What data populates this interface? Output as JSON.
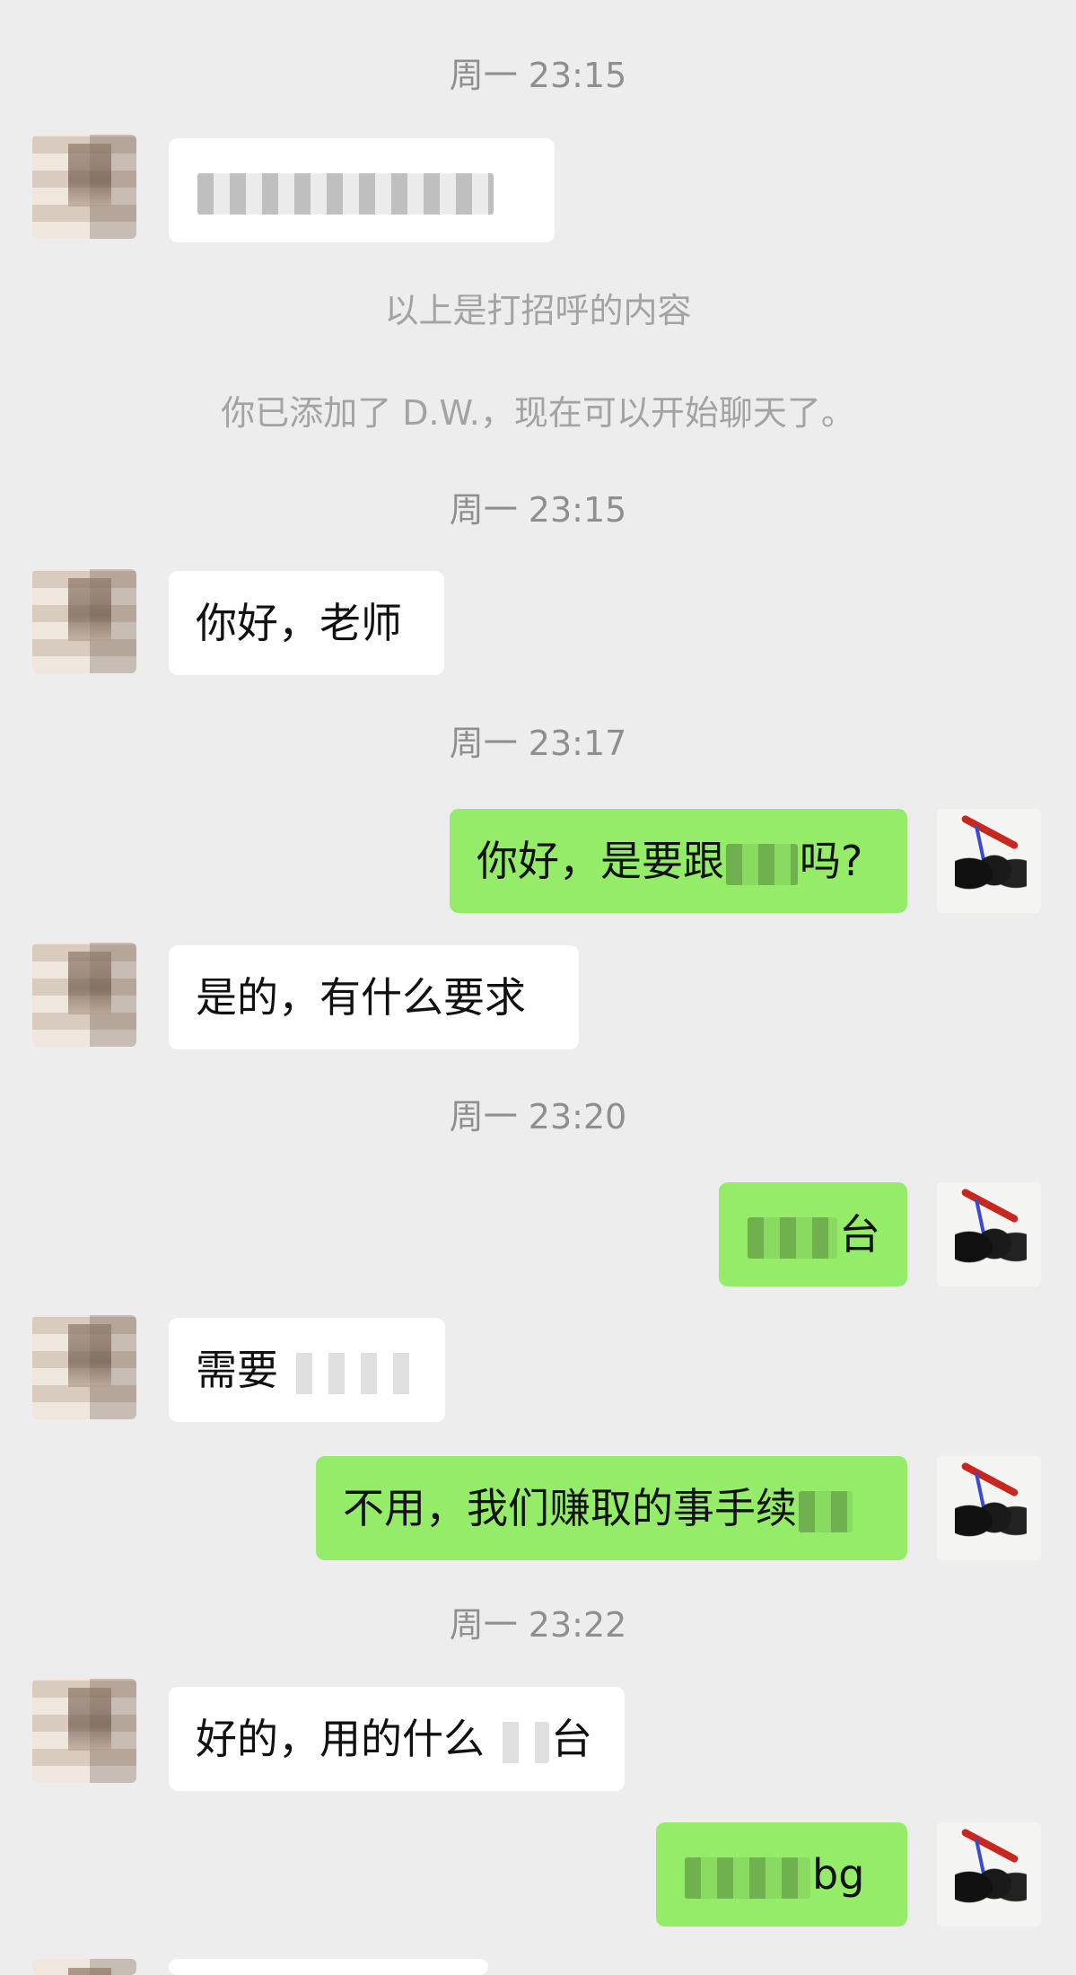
{
  "messages": {
    "t1": "周一 23:15",
    "m1_text": "",
    "sys1": "以上是打招呼的内容",
    "sys2": "你已添加了 D.W.，现在可以开始聊天了。",
    "t2": "周一 23:15",
    "m2_text": "你好，老师",
    "t3": "周一 23:17",
    "m3_pre": "你好，是要跟",
    "m3_post": "吗?",
    "m4_text": "是的，有什么要求",
    "t4": "周一 23:20",
    "m5_text": "台",
    "m6_text": "需要",
    "m7_text": "不用，我们赚取的事手续",
    "t5": "周一 23:22",
    "m8_pre": "好的，用的什么",
    "m8_post": "台",
    "m9_text": "bg"
  },
  "colors": {
    "background": "#ededed",
    "incoming_bubble": "#ffffff",
    "outgoing_bubble": "#95ec69",
    "timestamp": "#8f8f8f"
  },
  "icons": {
    "peer_avatar": "blurred-photo-avatar",
    "self_avatar": "ink-painting-avatar"
  }
}
